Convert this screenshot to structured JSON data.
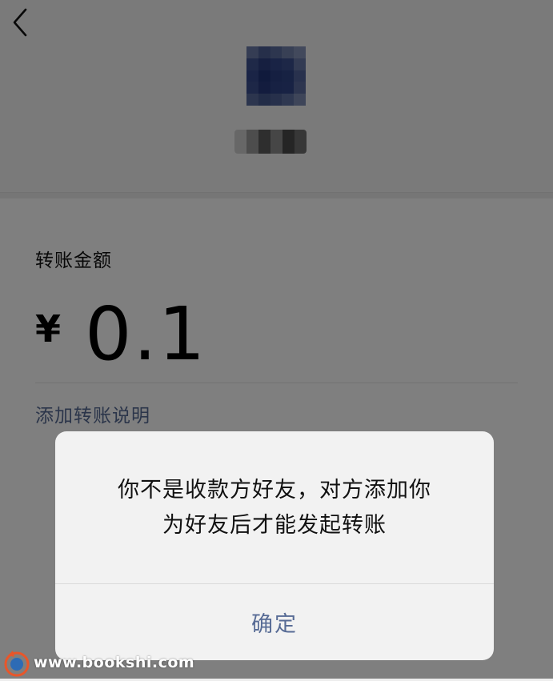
{
  "header": {
    "back_icon": "chevron-left-icon"
  },
  "transfer": {
    "amount_label": "转账金额",
    "currency_symbol": "¥",
    "amount": "0.1",
    "add_note_label": "添加转账说明"
  },
  "dialog": {
    "message_line1": "你不是收款方好友，对方添加你",
    "message_line2": "为好友后才能发起转账",
    "confirm_label": "确定"
  },
  "watermark": {
    "text": "www.bookshi.com"
  },
  "colors": {
    "link_blue": "#576b95",
    "dialog_bg": "#f2f2f2",
    "page_bg": "#ededed"
  }
}
